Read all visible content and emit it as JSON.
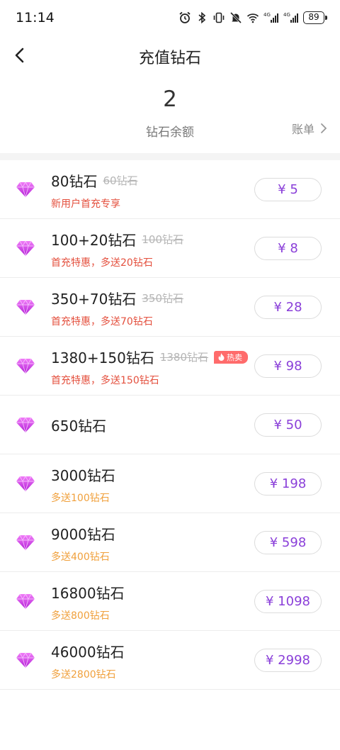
{
  "status_bar": {
    "time": "11:14",
    "battery": "89",
    "icons": [
      "alarm-icon",
      "bluetooth-icon",
      "vibrate-icon",
      "mute-icon",
      "wifi-icon",
      "signal-4g-icon",
      "signal-4g-icon"
    ]
  },
  "header": {
    "title": "充值钻石",
    "back_icon": "chevron-left-icon"
  },
  "balance": {
    "value": "2",
    "label": "钻石余额",
    "bill_label": "账单"
  },
  "colors": {
    "accent_purple": "#8a3fd9",
    "gem_magenta": "#d23cf0",
    "promo_red": "#e4503e",
    "bonus_orange": "#f0a03c",
    "hot_badge": "#ff6b6b"
  },
  "packages": [
    {
      "title": "80钻石",
      "original": "60钻石",
      "subtitle": "新用户首充专享",
      "subtitle_style": "red",
      "price": "¥ 5"
    },
    {
      "title": "100+20钻石",
      "original": "100钻石",
      "subtitle": "首充特惠，多送20钻石",
      "subtitle_style": "red",
      "price": "¥ 8"
    },
    {
      "title": "350+70钻石",
      "original": "350钻石",
      "subtitle": "首充特惠，多送70钻石",
      "subtitle_style": "red",
      "price": "¥ 28"
    },
    {
      "title": "1380+150钻石",
      "original": "1380钻石",
      "badge": "热卖",
      "subtitle": "首充特惠，多送150钻石",
      "subtitle_style": "red",
      "price": "¥ 98"
    },
    {
      "title": "650钻石",
      "price": "¥ 50"
    },
    {
      "title": "3000钻石",
      "subtitle": "多送100钻石",
      "subtitle_style": "orange",
      "price": "¥ 198"
    },
    {
      "title": "9000钻石",
      "subtitle": "多送400钻石",
      "subtitle_style": "orange",
      "price": "¥ 598"
    },
    {
      "title": "16800钻石",
      "subtitle": "多送800钻石",
      "subtitle_style": "orange",
      "price": "¥ 1098"
    },
    {
      "title": "46000钻石",
      "subtitle": "多送2800钻石",
      "subtitle_style": "orange",
      "price": "¥ 2998"
    }
  ]
}
